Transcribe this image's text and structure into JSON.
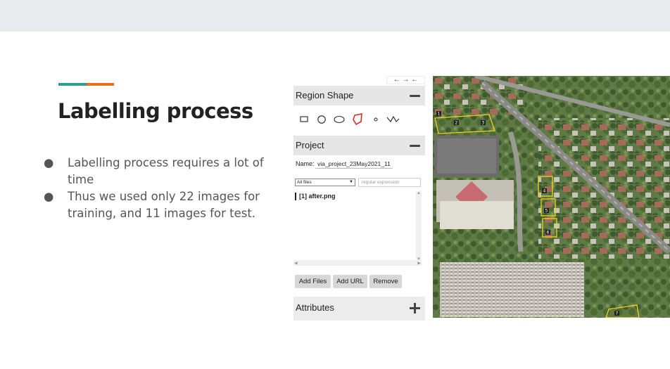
{
  "slide": {
    "title": "Labelling process",
    "bullets": [
      "Labelling process requires a lot of time",
      "Thus we used only 22 images for training, and 11 images for test."
    ],
    "accent_colors": [
      "#2a9d8f",
      "#e76f1a"
    ]
  },
  "via": {
    "nav_arrows": "← → ←",
    "region_shape": {
      "label": "Region Shape",
      "collapse_icon": "minus-icon",
      "shapes": [
        "rectangle-icon",
        "circle-icon",
        "ellipse-icon",
        "polygon-icon",
        "point-icon",
        "polyline-icon"
      ],
      "active_color": "#e02020"
    },
    "project": {
      "label": "Project",
      "collapse_icon": "minus-icon",
      "name_label": "Name:",
      "name_value": "via_project_23May2021_11",
      "filter_selected": "All files",
      "regex_placeholder": "regular expression",
      "files": [
        "[1] after.png"
      ],
      "buttons": {
        "add_files": "Add Files",
        "add_url": "Add URL",
        "remove": "Remove"
      }
    },
    "attributes": {
      "label": "Attributes",
      "expand_icon": "plus-icon"
    }
  },
  "aerial": {
    "annotation_color": "#f2d31b",
    "labels": [
      "1",
      "2",
      "3",
      "4",
      "5",
      "6",
      "7"
    ]
  }
}
